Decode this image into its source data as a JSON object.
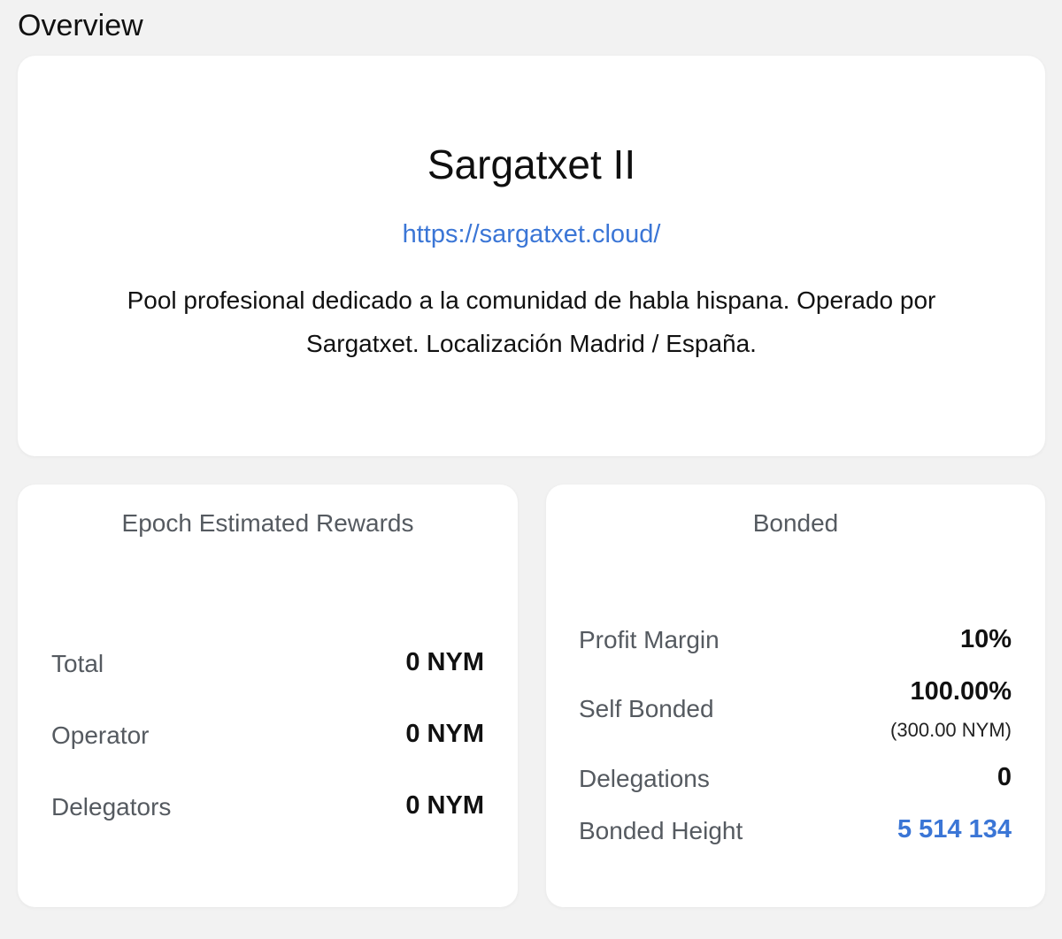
{
  "page": {
    "section_title": "Overview"
  },
  "node": {
    "name": "Sargatxet II",
    "url": "https://sargatxet.cloud/",
    "description": "Pool profesional dedicado a la comunidad de habla hispana. Operado por Sargatxet. Localización Madrid / España."
  },
  "rewards": {
    "title": "Epoch Estimated Rewards",
    "rows": [
      {
        "label": "Total",
        "value": "0 NYM"
      },
      {
        "label": "Operator",
        "value": "0 NYM"
      },
      {
        "label": "Delegators",
        "value": "0 NYM"
      }
    ]
  },
  "bonded": {
    "title": "Bonded",
    "profit_margin": {
      "label": "Profit Margin",
      "value": "10%"
    },
    "self_bonded": {
      "label": "Self Bonded",
      "value": "100.00%",
      "sub": "(300.00 NYM)"
    },
    "delegations": {
      "label": "Delegations",
      "value": "0"
    },
    "bonded_height": {
      "label": "Bonded Height",
      "value": "5 514 134"
    }
  },
  "colors": {
    "background": "#f2f2f2",
    "card": "#ffffff",
    "link": "#3b76d6",
    "label": "#555a60",
    "text": "#111111"
  }
}
